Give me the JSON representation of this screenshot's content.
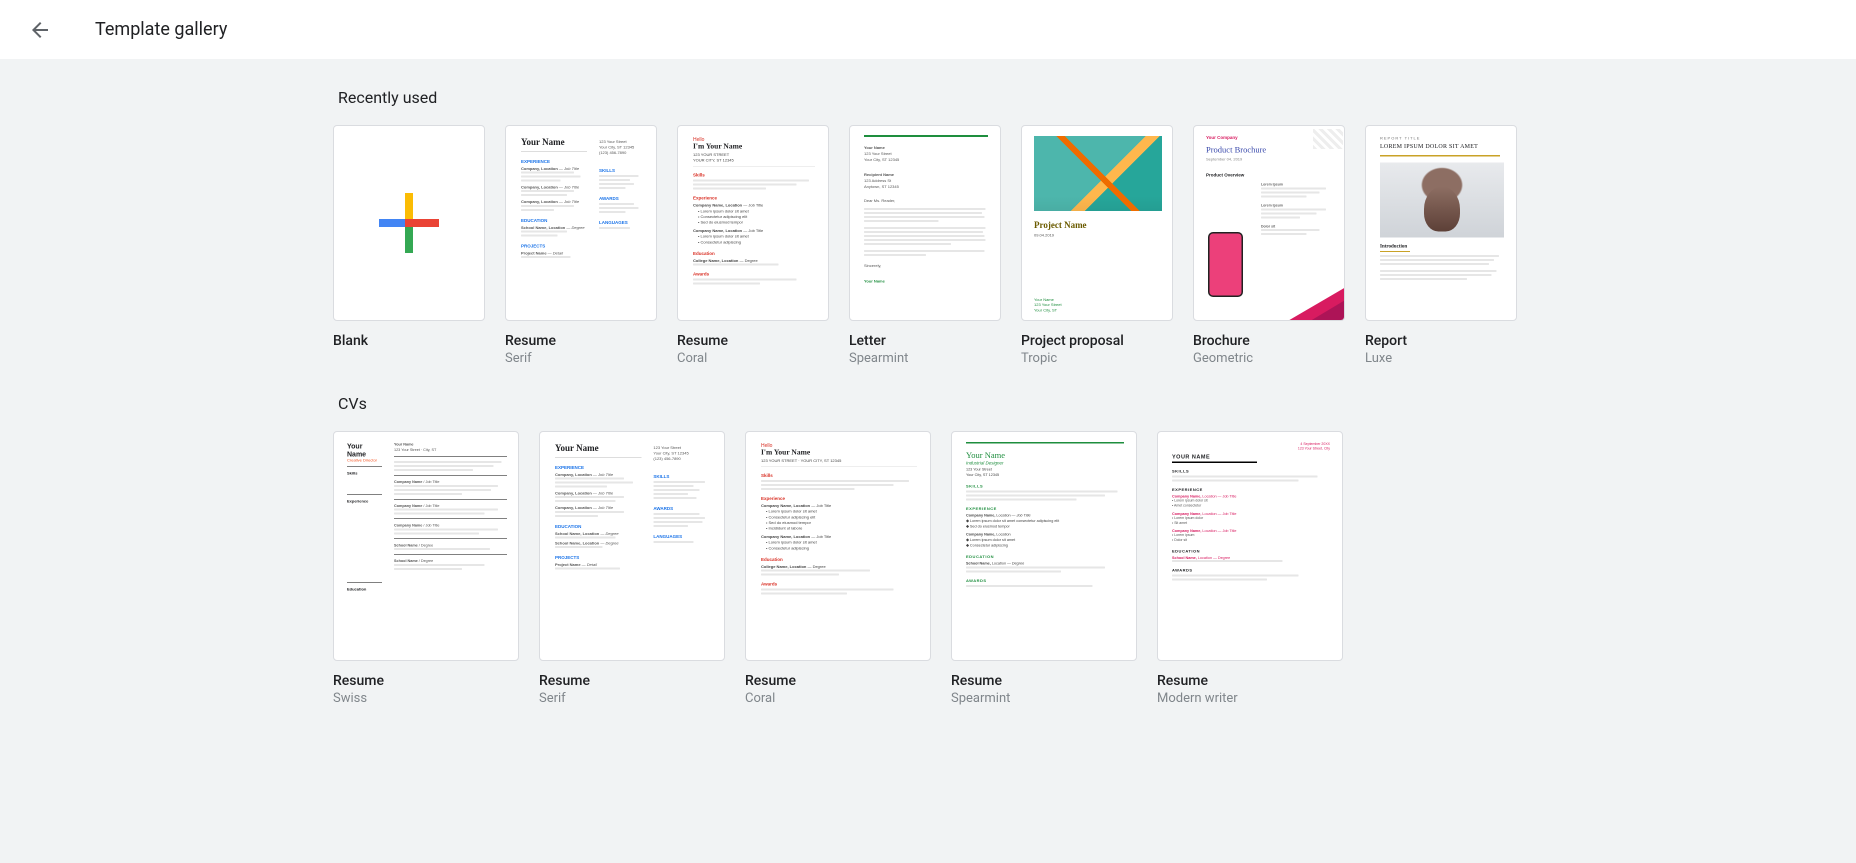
{
  "header": {
    "title": "Template gallery"
  },
  "sections": {
    "recent": {
      "title": "Recently used",
      "items": [
        {
          "title": "Blank",
          "subtitle": ""
        },
        {
          "title": "Resume",
          "subtitle": "Serif"
        },
        {
          "title": "Resume",
          "subtitle": "Coral"
        },
        {
          "title": "Letter",
          "subtitle": "Spearmint"
        },
        {
          "title": "Project proposal",
          "subtitle": "Tropic"
        },
        {
          "title": "Brochure",
          "subtitle": "Geometric"
        },
        {
          "title": "Report",
          "subtitle": "Luxe"
        }
      ]
    },
    "cv": {
      "title": "CVs",
      "items": [
        {
          "title": "Resume",
          "subtitle": "Swiss"
        },
        {
          "title": "Resume",
          "subtitle": "Serif"
        },
        {
          "title": "Resume",
          "subtitle": "Coral"
        },
        {
          "title": "Resume",
          "subtitle": "Spearmint"
        },
        {
          "title": "Resume",
          "subtitle": "Modern writer"
        }
      ]
    }
  },
  "previews": {
    "serif": {
      "name_label": "Your Name"
    },
    "coral": {
      "hello": "Hello",
      "name_label": "I'm Your Name"
    },
    "letter": {
      "signature": "Your Name"
    },
    "project": {
      "name": "Project Name",
      "footer": "Your Name"
    },
    "brochure": {
      "company": "Your Company",
      "title": "Product Brochure",
      "section": "Product Overview"
    },
    "report": {
      "tag": "REPORT TITLE",
      "title": "LOREM IPSUM DOLOR SIT AMET",
      "section": "Introduction"
    },
    "swiss": {
      "left_name": "Your Name",
      "left_role": "Creative Director",
      "right_name": "Your Name",
      "skills_lbl": "Skills",
      "exp_lbl": "Experience",
      "edu_lbl": "Education"
    },
    "spearmint": {
      "name": "Your Name",
      "role": "Industrial Designer",
      "skills": "SKILLS",
      "exp": "EXPERIENCE",
      "edu": "EDUCATION",
      "awards": "AWARDS"
    },
    "modern": {
      "name": "YOUR NAME",
      "skills": "SKILLS",
      "exp": "EXPERIENCE",
      "edu": "EDUCATION",
      "awards": "AWARDS"
    }
  }
}
